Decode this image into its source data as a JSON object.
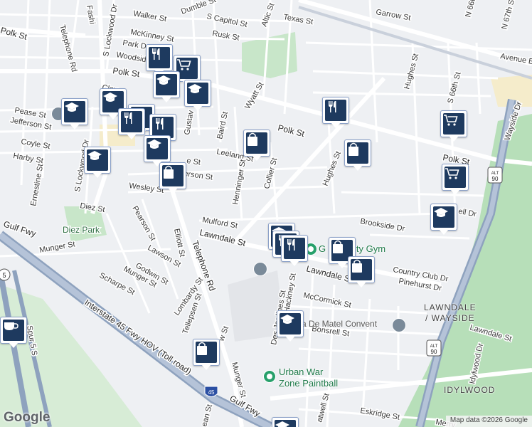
{
  "map": {
    "attribution": "Map data ©2026 Google",
    "logo": "Google",
    "area_labels": {
      "lawndale_wayside_line1": "LAWNDALE",
      "lawndale_wayside_line2": "/ WAYSIDE",
      "idylwood": "IDYLWOOD"
    },
    "pois": {
      "gym": "Gym",
      "gym_partial": "G",
      "gym_suffix": "ity Gym",
      "paintball_line1": "Urban War",
      "paintball_line2": "Zone Paintball",
      "diez_park": "Diez Park",
      "convent": "a De Matel Convent"
    },
    "streets": {
      "telephone_rd_top": "Telephone Rd",
      "fashion": "Fashi",
      "walker": "Walker St",
      "mckinney": "McKinney St",
      "park_dr": "Park Dr",
      "woodside": "Woodside",
      "dumble": "Dumble St",
      "s_capitol": "S Capitol St",
      "rusk": "Rusk St",
      "altic": "Altic St",
      "texas": "Texas St",
      "garrow": "Garrow St",
      "n_66th": "N 66th",
      "n_67th": "N 67th St",
      "avenue_b": "Avenue B",
      "s_lockwood_top": "S Lockwood Dr",
      "polk_left": "Polk St",
      "polk_mid": "Polk St",
      "polk_right": "Polk St",
      "clay": "Clay",
      "pease": "Pease St",
      "jefferson_left": "Jefferson St",
      "coyle": "Coyle St",
      "harby": "Harby St",
      "ernestine": "Ernestine St",
      "s_lockwood_mid": "S Lockwood Dr",
      "gustav": "Gustav",
      "baird": "Baird St",
      "wyatt": "Wyatt St",
      "leeland": "Leeland St",
      "jefferson_mid": "erson St",
      "e_st": "e St",
      "henninger": "Henninger St",
      "collier": "Collier St",
      "hughes_top": "Hughes St",
      "hughes_mid": "Hughes St",
      "s_66th": "S 66th St",
      "wayside": "Wayside Dr",
      "wesley": "Wesley St",
      "diez": "Diez St",
      "pearson": "Pearson St",
      "mulford": "Mulford St",
      "brookside": "Brookside Dr",
      "lawndale_left": "Lawndale St",
      "lawndale_mid": "Lawndale St",
      "lawndale_right": "Lawndale St",
      "munger_left": "Munger St",
      "gulf_fwy": "Gulf Fwy",
      "elliott": "Elliott St",
      "lawson": "Lawson St",
      "godwin": "Godwin St",
      "telephone_rd_mid": "Telephone Rd",
      "munger_mid": "Munger St",
      "scharpe": "Scharpe St",
      "lombardy": "Lombardy St",
      "country_club": "Country Club Dr",
      "pinehurst": "Pinehurst Dr",
      "des_jardines": "Des Jardines St",
      "hackney": "Hackney St",
      "mccormick": "McCormick St",
      "interstate_45": "Interstate 45 Fwy HOV (Toll road)",
      "tellepsen": "Tellepsen St",
      "w_st": "w St",
      "bonsrell": "Bonsrell St",
      "idylwood_dr": "Idylwood Dr",
      "spur_5": "Spur 5 S",
      "munger_bottom": "Munger St",
      "gulf_fwy_bottom": "Gulf Fwy",
      "eskridge": "Eskridge St",
      "merry": "Merry",
      "ean_st": "ean St",
      "atwell": "atwell St",
      "shell_dr": "ell Dr"
    },
    "shields": {
      "i45": "45",
      "alt90_top": "ALT 90",
      "alt90_bottom": "ALT 90",
      "route5": "5"
    },
    "markers": [
      {
        "type": "restaurant",
        "icon": "fork-knife-icon"
      },
      {
        "type": "grocery",
        "icon": "cart-icon"
      },
      {
        "type": "school",
        "icon": "graduation-cap-icon"
      },
      {
        "type": "school",
        "icon": "graduation-cap-icon"
      },
      {
        "type": "school",
        "icon": "graduation-cap-icon"
      },
      {
        "type": "school",
        "icon": "graduation-cap-icon"
      },
      {
        "type": "restaurant",
        "icon": "fork-knife-icon"
      },
      {
        "type": "restaurant",
        "icon": "fork-knife-icon"
      },
      {
        "type": "restaurant",
        "icon": "fork-knife-icon"
      },
      {
        "type": "school",
        "icon": "graduation-cap-icon"
      },
      {
        "type": "school",
        "icon": "graduation-cap-icon"
      },
      {
        "type": "shopping",
        "icon": "shopping-bag-icon"
      },
      {
        "type": "shopping",
        "icon": "shopping-bag-icon"
      },
      {
        "type": "restaurant",
        "icon": "fork-knife-icon"
      },
      {
        "type": "shopping",
        "icon": "shopping-bag-icon"
      },
      {
        "type": "grocery",
        "icon": "cart-icon"
      },
      {
        "type": "grocery",
        "icon": "cart-icon"
      },
      {
        "type": "school",
        "icon": "graduation-cap-icon"
      },
      {
        "type": "school",
        "icon": "graduation-cap-icon"
      },
      {
        "type": "restaurant",
        "icon": "fork-knife-icon"
      },
      {
        "type": "restaurant",
        "icon": "fork-knife-icon"
      },
      {
        "type": "shopping",
        "icon": "shopping-bag-icon"
      },
      {
        "type": "shopping",
        "icon": "shopping-bag-icon"
      },
      {
        "type": "school",
        "icon": "graduation-cap-icon"
      },
      {
        "type": "shopping",
        "icon": "shopping-bag-icon"
      },
      {
        "type": "cafe",
        "icon": "coffee-cup-icon"
      },
      {
        "type": "school",
        "icon": "graduation-cap-icon"
      }
    ],
    "colors": {
      "background": "#eef0f3",
      "road": "#ffffff",
      "highway": "#8ea2be",
      "park": "#b7dfb9",
      "marker_fill": "#1e3a5f",
      "poi_green": "#1f7a4a"
    }
  }
}
